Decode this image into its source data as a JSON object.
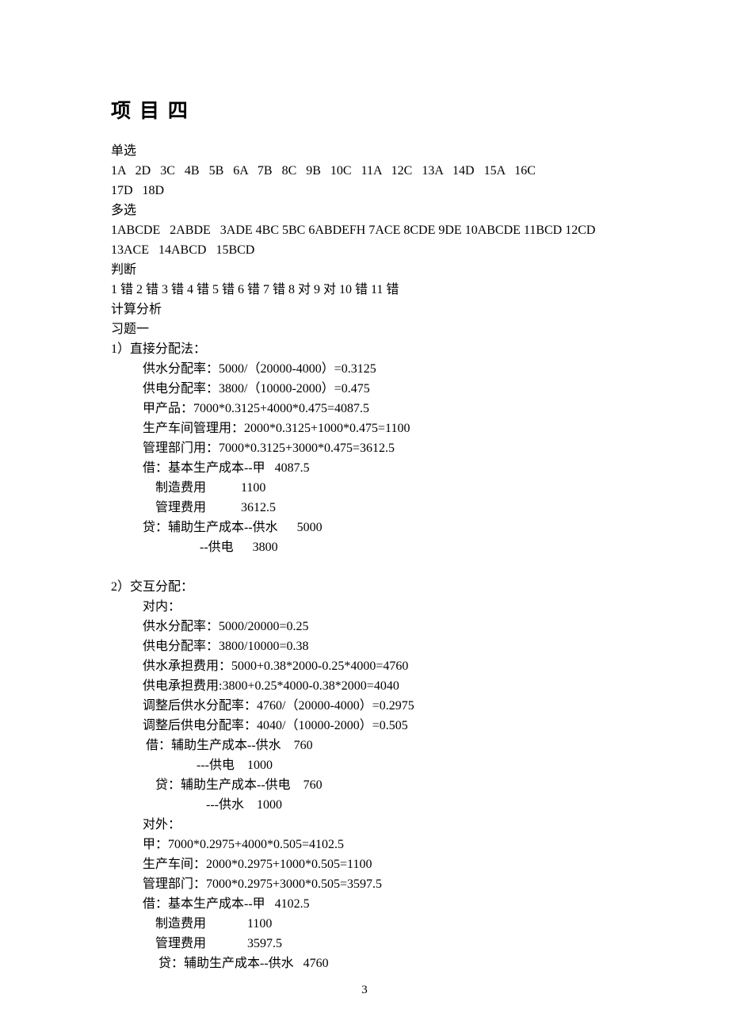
{
  "title": "项 目 四",
  "lines": {
    "l01": "单选",
    "l02": "1A   2D   3C   4B   5B   6A   7B   8C   9B   10C   11A   12C   13A   14D   15A   16C",
    "l03": "17D   18D",
    "l04": "多选",
    "l05": "1ABCDE   2ABDE   3ADE 4BC 5BC 6ABDEFH 7ACE 8CDE 9DE 10ABCDE 11BCD 12CD",
    "l06": "13ACE   14ABCD   15BCD",
    "l07": "判断",
    "l08": "1 错 2 错 3 错 4 错 5 错 6 错 7 错 8 对 9 对 10 错 11 错",
    "l09": "计算分析",
    "l10": "习题一",
    "l11": "1）直接分配法：",
    "l12": "供水分配率：5000/（20000-4000）=0.3125",
    "l13": "供电分配率：3800/（10000-2000）=0.475",
    "l14": "甲产品：7000*0.3125+4000*0.475=4087.5",
    "l15": "生产车间管理用：2000*0.3125+1000*0.475=1100",
    "l16": "管理部门用：7000*0.3125+3000*0.475=3612.5",
    "l17": "借：基本生产成本--甲   4087.5",
    "l18": "    制造费用           1100",
    "l19": "    管理费用           3612.5",
    "l20": "贷：辅助生产成本--供水      5000",
    "l21": "                  --供电      3800",
    "l22": "2）交互分配：",
    "l23": "对内：",
    "l24": "供水分配率：5000/20000=0.25",
    "l25": "供电分配率：3800/10000=0.38",
    "l26": "供水承担费用：5000+0.38*2000-0.25*4000=4760",
    "l27": "供电承担费用:3800+0.25*4000-0.38*2000=4040",
    "l28": "调整后供水分配率：4760/（20000-4000）=0.2975",
    "l29": "调整后供电分配率：4040/（10000-2000）=0.505",
    "l30": " 借：辅助生产成本--供水    760",
    "l31": "                 ---供电    1000",
    "l32": "    贷：辅助生产成本--供电    760",
    "l33": "                    ---供水    1000",
    "l34": "对外：",
    "l35": "甲：7000*0.2975+4000*0.505=4102.5",
    "l36": "生产车间：2000*0.2975+1000*0.505=1100",
    "l37": "管理部门：7000*0.2975+3000*0.505=3597.5",
    "l38": "借：基本生产成本--甲   4102.5",
    "l39": "    制造费用             1100",
    "l40": "    管理费用             3597.5",
    "l41": "     贷：辅助生产成本--供水   4760"
  },
  "pagenum": "3"
}
